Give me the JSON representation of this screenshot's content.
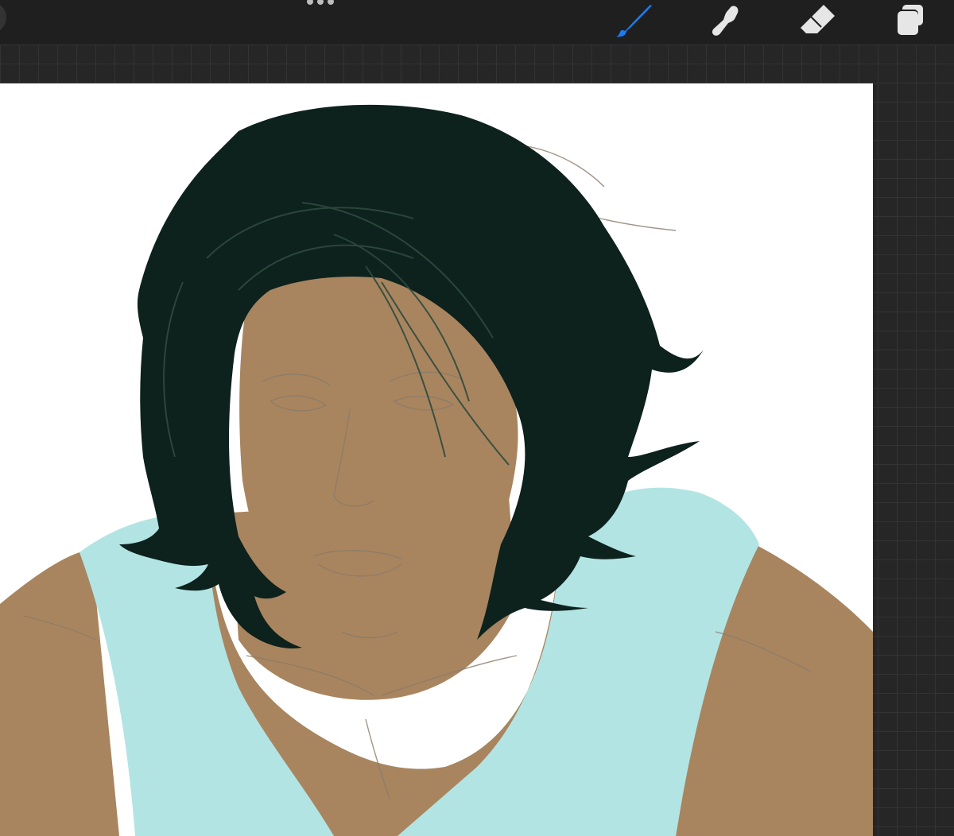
{
  "app": {
    "toolbar": {
      "more_menu_icon": "more-dots-icon",
      "tools": [
        {
          "name": "brush",
          "icon": "brush-icon",
          "active": true,
          "color": "#1a7cf5"
        },
        {
          "name": "smudge",
          "icon": "smudge-icon",
          "active": false,
          "color": "#e6e6e6"
        },
        {
          "name": "eraser",
          "icon": "eraser-icon",
          "active": false,
          "color": "#e6e6e6"
        },
        {
          "name": "layers",
          "icon": "layers-icon",
          "active": false,
          "color": "#e6e6e6"
        }
      ]
    },
    "canvas": {
      "background": "#ffffff",
      "colors": {
        "hair": "#0d211d",
        "skin": "#a8855f",
        "shirt": "#b2e4e4",
        "sketch": "#8a7a6a"
      }
    }
  }
}
